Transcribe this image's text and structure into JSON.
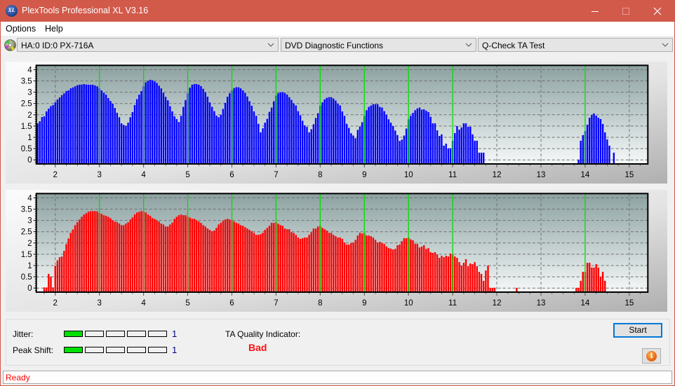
{
  "window": {
    "title": "PlexTools Professional XL V3.16",
    "icon": "xl-logo-icon",
    "icon_text": "XL",
    "controls": [
      "minimize-icon",
      "maximize-icon",
      "close-icon"
    ],
    "accent_color": "#d25a4b"
  },
  "menu": [
    {
      "label": "Options"
    },
    {
      "label": "Help"
    }
  ],
  "toolbar": {
    "drive_icon": "disc-drive-icon",
    "drive": "HA:0 ID:0  PX-716A",
    "function": "DVD Diagnostic Functions",
    "test": "Q-Check TA Test"
  },
  "chart_data": [
    {
      "type": "bar",
      "panel": "upper",
      "title": "",
      "xlabel": "",
      "ylabel": "",
      "xlim": [
        1.57,
        15.42
      ],
      "ylim": [
        -0.18,
        4.19
      ],
      "xticks": [
        "2",
        "3",
        "4",
        "5",
        "6",
        "7",
        "8",
        "9",
        "10",
        "11",
        "12",
        "13",
        "14",
        "15"
      ],
      "yticks": [
        "0",
        "0.5",
        "1",
        "1.5",
        "2",
        "2.5",
        "3",
        "3.5",
        "4"
      ],
      "grid": true,
      "reference_lines_x": [
        3,
        4,
        5,
        6,
        7,
        8,
        9,
        10,
        11,
        14
      ],
      "reference_color": "#00e000",
      "series": [
        {
          "name": "",
          "color": "#0000ff",
          "segments": [
            {
              "x_start": 1.6,
              "x_step": 0.05,
              "values": [
                1.62,
                1.71,
                1.9,
                1.93,
                2.15,
                2.27,
                2.38,
                2.43,
                2.55,
                2.68,
                2.77,
                2.87,
                2.95,
                3.05,
                3.08,
                3.17,
                3.21,
                3.26,
                3.31,
                3.33,
                3.34,
                3.36,
                3.34,
                3.33,
                3.33,
                3.33,
                3.3,
                3.26,
                3.17,
                3.08,
                2.98,
                2.89,
                2.74,
                2.61,
                2.49,
                2.3,
                2.09,
                1.89,
                1.62,
                1.55,
                1.5,
                1.65,
                1.89,
                2.12,
                2.43,
                2.69,
                2.89,
                3.05,
                3.26,
                3.44,
                3.51,
                3.55,
                3.53,
                3.48,
                3.41,
                3.29,
                3.17,
                2.98,
                2.79,
                2.64,
                2.38,
                2.15,
                1.93,
                1.81,
                1.68,
                1.95,
                2.35,
                2.65,
                2.95,
                3.2,
                3.33,
                3.36,
                3.36,
                3.33,
                3.27,
                3.15,
                3.0,
                2.8,
                2.55,
                2.35,
                2.16,
                1.96,
                1.89,
                2.0,
                2.26,
                2.53,
                2.8,
                2.95,
                3.08,
                3.18,
                3.22,
                3.22,
                3.17,
                3.08,
                2.97,
                2.81,
                2.6,
                2.4,
                2.15,
                1.95,
                1.6,
                1.22,
                1.4,
                1.65,
                1.82,
                2.13,
                2.32,
                2.6,
                2.85,
                2.96,
                3.0,
                3.0,
                2.97,
                2.9,
                2.78,
                2.66,
                2.51,
                2.41,
                2.16,
                1.98,
                1.73,
                1.53,
                1.46,
                1.22,
                1.36,
                1.58,
                1.86,
                2.07,
                2.4,
                2.55,
                2.68,
                2.75,
                2.78,
                2.78,
                2.72,
                2.63,
                2.49,
                2.41,
                2.15,
                1.95,
                1.6,
                1.42,
                1.18,
                1.08,
                0.96,
                1.33,
                1.48,
                1.67,
                1.95,
                2.2,
                2.35,
                2.41,
                2.47,
                2.47,
                2.47,
                2.35,
                2.32,
                2.16,
                2.0,
                1.8,
                1.65,
                1.5,
                1.3,
                1.1,
                0.84,
                0.9,
                1.08,
                1.39,
                1.8,
                1.95,
                2.08,
                2.2,
                2.28,
                2.32,
                2.23,
                2.24,
                2.18,
                2.12,
                1.91,
                1.62,
                1.62,
                1.31,
                1.06,
                1.13,
                0.63,
                0.72,
                0.51,
                0.51,
                0.85,
                1.19,
                1.5,
                1.34,
                1.44,
                1.62,
                1.62,
                1.47,
                1.47,
                1.13,
                0.85,
                0.85,
                0.32,
                0.32,
                0.32
              ]
            },
            {
              "x_start": 13.85,
              "x_step": 0.05,
              "values": [
                0.01,
                0.85,
                1.1,
                1.28,
                1.56,
                1.87,
                1.99,
                2.06,
                1.96,
                1.87,
                1.81,
                1.59,
                1.22,
                0.91,
                0.63,
                null,
                0.32
              ]
            }
          ]
        }
      ]
    },
    {
      "type": "bar",
      "panel": "lower",
      "title": "",
      "xlabel": "",
      "ylabel": "",
      "xlim": [
        1.57,
        15.42
      ],
      "ylim": [
        -0.18,
        4.19
      ],
      "xticks": [
        "2",
        "3",
        "4",
        "5",
        "6",
        "7",
        "8",
        "9",
        "10",
        "11",
        "12",
        "13",
        "14",
        "15"
      ],
      "yticks": [
        "0",
        "0.5",
        "1",
        "1.5",
        "2",
        "2.5",
        "3",
        "3.5",
        "4"
      ],
      "grid": true,
      "reference_lines_x": [
        3,
        4,
        5,
        6,
        7,
        8,
        9,
        10,
        11,
        14
      ],
      "reference_color": "#00e000",
      "series": [
        {
          "name": "",
          "color": "#ff0000",
          "segments": [
            {
              "x_start": 1.75,
              "x_step": 0.05,
              "values": [
                0.03,
                0.03,
                0.63,
                0.51,
                0.03,
                0.99,
                1.23,
                1.37,
                1.4,
                1.65,
                1.95,
                2.2,
                2.45,
                2.6,
                2.79,
                2.92,
                3.04,
                3.16,
                3.26,
                3.32,
                3.38,
                3.41,
                3.41,
                3.41,
                3.4,
                3.33,
                3.29,
                3.23,
                3.2,
                3.16,
                3.1,
                3.01,
                2.95,
                2.92,
                2.86,
                2.79,
                2.79,
                2.86,
                2.92,
                3.04,
                3.13,
                3.26,
                3.35,
                3.38,
                3.41,
                3.4,
                3.35,
                3.26,
                3.2,
                3.1,
                3.07,
                3.01,
                2.95,
                2.86,
                2.82,
                2.73,
                2.73,
                2.82,
                2.9,
                3.07,
                3.16,
                3.23,
                3.26,
                3.23,
                3.23,
                3.16,
                3.13,
                3.07,
                3.07,
                3.01,
                2.95,
                2.89,
                2.79,
                2.73,
                2.64,
                2.58,
                2.52,
                2.55,
                2.67,
                2.82,
                2.89,
                2.98,
                3.04,
                3.07,
                3.04,
                3.02,
                2.95,
                2.89,
                2.86,
                2.79,
                2.76,
                2.7,
                2.64,
                2.58,
                2.52,
                2.45,
                2.36,
                2.36,
                2.39,
                2.45,
                2.58,
                2.67,
                2.76,
                2.89,
                2.89,
                2.92,
                2.85,
                2.79,
                2.76,
                2.64,
                2.61,
                2.61,
                2.48,
                2.45,
                2.36,
                2.24,
                2.18,
                2.21,
                2.24,
                2.24,
                2.36,
                2.48,
                2.64,
                2.64,
                2.73,
                2.76,
                2.67,
                2.61,
                2.55,
                2.45,
                2.45,
                2.36,
                2.3,
                2.24,
                2.24,
                2.18,
                2.02,
                1.93,
                1.93,
                1.99,
                2.02,
                2.14,
                2.33,
                2.45,
                2.42,
                2.45,
                2.33,
                2.33,
                2.3,
                2.24,
                2.14,
                2.02,
                2.05,
                1.99,
                1.96,
                1.85,
                1.78,
                1.75,
                1.71,
                1.74,
                1.9,
                1.93,
                2.08,
                2.21,
                2.21,
                2.24,
                2.16,
                2.12,
                1.96,
                1.96,
                1.8,
                1.84,
                1.9,
                1.74,
                1.77,
                1.59,
                1.56,
                1.59,
                1.49,
                1.34,
                1.43,
                1.37,
                1.43,
                1.4,
                1.53,
                1.49,
                1.4,
                1.34,
                1.15,
                1.0,
                1.12,
                1.28,
                0.97,
                1.09,
                1.06,
                1.15,
                0.97,
                0.72,
                0.63,
                0.32,
                0.78,
                1.0,
                0.01,
                0.01,
                0.01
              ]
            },
            {
              "x_start": 12.45,
              "x_step": 0.05,
              "values": [
                0.01
              ]
            },
            {
              "x_start": 13.8,
              "x_step": 0.05,
              "values": [
                0.01,
                0.01,
                0.32,
                0.72,
                0.72,
                1.12,
                1.12,
                0.91,
                0.91,
                1.06,
                0.91,
                0.51,
                0.72,
                0.32
              ]
            }
          ]
        }
      ]
    }
  ],
  "indicators": {
    "jitter": {
      "label": "Jitter:",
      "level": 1,
      "max": 5,
      "value_text": "1"
    },
    "peak_shift": {
      "label": "Peak Shift:",
      "level": 1,
      "max": 5,
      "value_text": "1"
    },
    "segment_on_color": "#00e000",
    "ta_quality": {
      "label": "TA Quality Indicator:",
      "value": "Bad",
      "color": "#ff1010"
    }
  },
  "buttons": {
    "start": "Start",
    "info_icon": "info-icon",
    "info_glyph": "i"
  },
  "status": {
    "text": "Ready"
  }
}
